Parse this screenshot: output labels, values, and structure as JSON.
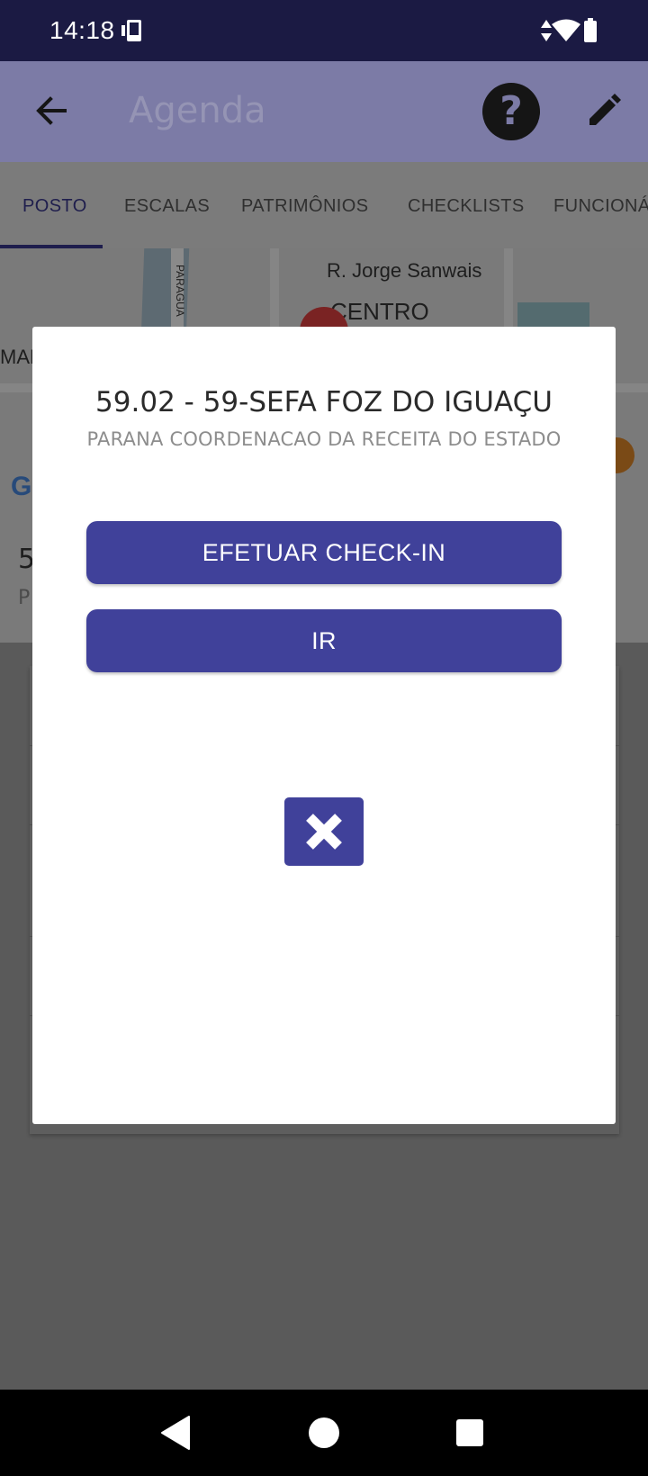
{
  "status_bar": {
    "time": "14:18",
    "icons": [
      "device-icon",
      "data-arrows-icon",
      "wifi-icon",
      "battery-icon"
    ]
  },
  "app_bar": {
    "title": "Agenda",
    "back_icon": "arrow-back-icon",
    "help_icon": "help-circle-icon",
    "help_glyph": "?",
    "edit_icon": "pencil-icon"
  },
  "tabs": [
    {
      "label": "POSTO",
      "active": true
    },
    {
      "label": "ESCALAS",
      "active": false
    },
    {
      "label": "PATRIMÔNIOS",
      "active": false
    },
    {
      "label": "CHECKLISTS",
      "active": false
    },
    {
      "label": "FUNCIONÁ",
      "active": false
    }
  ],
  "map": {
    "labels": {
      "street": "R. Jorge Sanwais",
      "district": "CENTRO",
      "road_vertical": "PARAGUA",
      "left_edge": "MAN",
      "google_g": "G"
    }
  },
  "background_card": {
    "line1": "5",
    "line2": "P"
  },
  "dialog": {
    "title": "59.02 - 59-SEFA FOZ DO IGUAÇU",
    "subtitle": "PARANA COORDENACAO DA RECEITA DO ESTADO",
    "checkin_label": "EFETUAR CHECK-IN",
    "go_label": "IR",
    "close_icon": "close-x-icon"
  },
  "nav_bar": {
    "icons": [
      "back-triangle-icon",
      "home-circle-icon",
      "recents-square-icon"
    ]
  },
  "colors": {
    "status_bar": "#1b1a43",
    "primary_button": "#40419a",
    "dialog_bg": "#ffffff",
    "scrim": "#5a5a5a"
  }
}
